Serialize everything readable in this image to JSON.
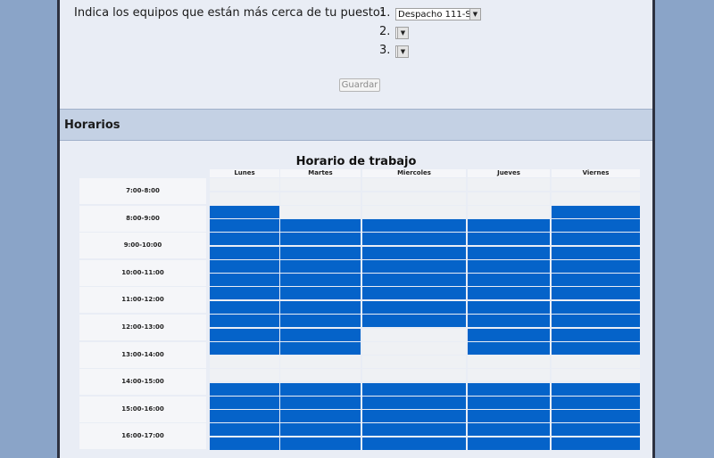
{
  "equipos": {
    "label": "Indica los equipos que están más cerca de tu puesto:",
    "slots": [
      {
        "num": "1.",
        "value": "Despacho 111-S"
      },
      {
        "num": "2.",
        "value": ""
      },
      {
        "num": "3.",
        "value": ""
      }
    ],
    "save_label": "Guardar"
  },
  "section": {
    "title": "Horarios"
  },
  "schedule": {
    "title": "Horario de trabajo",
    "days": [
      "Lunes",
      "Martes",
      "Miercoles",
      "Jueves",
      "Viernes"
    ],
    "hours": [
      "7:00-8:00",
      "8:00-9:00",
      "9:00-10:00",
      "10:00-11:00",
      "11:00-12:00",
      "12:00-13:00",
      "13:00-14:00",
      "14:00-15:00",
      "15:00-16:00",
      "16:00-17:00"
    ],
    "busy": [
      [
        0,
        0,
        0,
        0,
        0
      ],
      [
        0,
        0,
        0,
        0,
        0
      ],
      [
        1,
        0,
        0,
        0,
        1
      ],
      [
        1,
        1,
        1,
        1,
        1
      ],
      [
        1,
        1,
        1,
        1,
        1
      ],
      [
        1,
        1,
        1,
        1,
        1
      ],
      [
        1,
        1,
        1,
        1,
        1
      ],
      [
        1,
        1,
        1,
        1,
        1
      ],
      [
        1,
        1,
        1,
        1,
        1
      ],
      [
        1,
        1,
        1,
        1,
        1
      ],
      [
        1,
        1,
        1,
        1,
        1
      ],
      [
        1,
        1,
        0,
        1,
        1
      ],
      [
        1,
        1,
        0,
        1,
        1
      ],
      [
        0,
        0,
        0,
        0,
        0
      ],
      [
        0,
        0,
        0,
        0,
        0
      ],
      [
        1,
        1,
        1,
        1,
        1
      ],
      [
        1,
        1,
        1,
        1,
        1
      ],
      [
        1,
        1,
        1,
        1,
        1
      ],
      [
        1,
        1,
        1,
        1,
        1
      ],
      [
        1,
        1,
        1,
        1,
        1
      ]
    ]
  }
}
